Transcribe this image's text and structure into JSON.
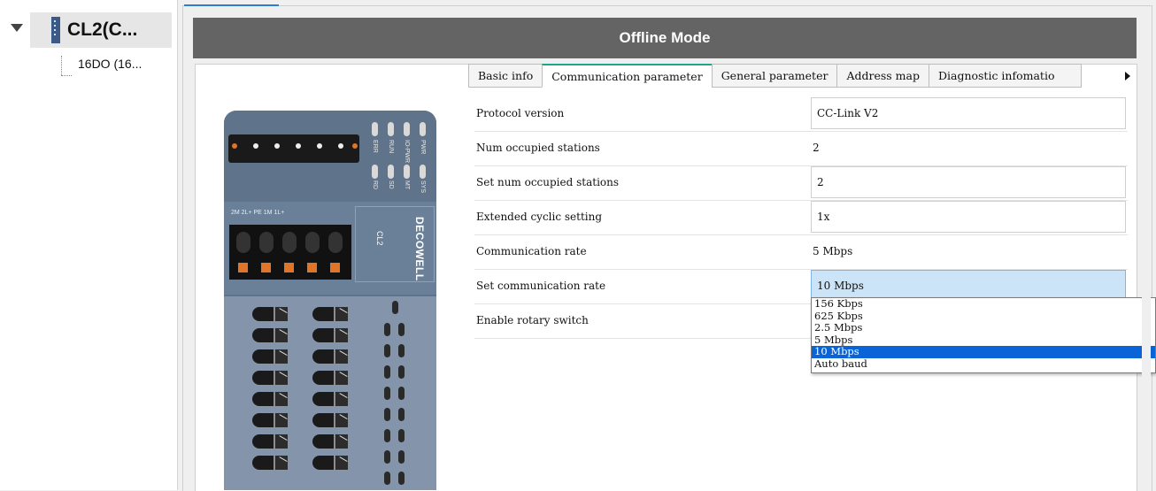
{
  "sidebar": {
    "root_label": "CL2(C...",
    "child_label": "16DO (16..."
  },
  "header": {
    "title": "Offline Mode"
  },
  "device_image": {
    "brand": "DECOWELL",
    "model": "CL2",
    "led_labels_top": [
      "PWR",
      "IO-PWR",
      "RUN",
      "ERR"
    ],
    "led_labels_bottom": [
      "SYS",
      "MT",
      "SD",
      "RD"
    ],
    "terminal_labels": "2M   2L+   PE   1M   1L+"
  },
  "tabs": [
    {
      "label": "Basic info",
      "active": false
    },
    {
      "label": "Communication parameter",
      "active": true
    },
    {
      "label": "General parameter",
      "active": false
    },
    {
      "label": "Address map",
      "active": false
    },
    {
      "label": "Diagnostic infomatio",
      "active": false
    }
  ],
  "params": [
    {
      "label": "Protocol version",
      "value": "CC-Link V2",
      "style": "boxed"
    },
    {
      "label": "Num occupied stations",
      "value": "2",
      "style": "plain"
    },
    {
      "label": "Set num occupied stations",
      "value": "2",
      "style": "boxed"
    },
    {
      "label": "Extended cyclic setting",
      "value": "1x",
      "style": "boxed"
    },
    {
      "label": "Communication rate",
      "value": "5 Mbps",
      "style": "plain"
    },
    {
      "label": "Set communication rate",
      "value": "10 Mbps",
      "style": "selected"
    },
    {
      "label": "Enable rotary switch",
      "value": "",
      "style": "plain"
    }
  ],
  "rate_dropdown": {
    "options": [
      "156 Kbps",
      "625 Kbps",
      "2.5 Mbps",
      "5 Mbps",
      "10 Mbps",
      "Auto baud"
    ],
    "selected": "10 Mbps"
  },
  "colors": {
    "header_bg": "#646464",
    "active_tab_accent": "#1fa58b",
    "selection": "#0a64d8",
    "selected_cell": "#cce4f7"
  }
}
